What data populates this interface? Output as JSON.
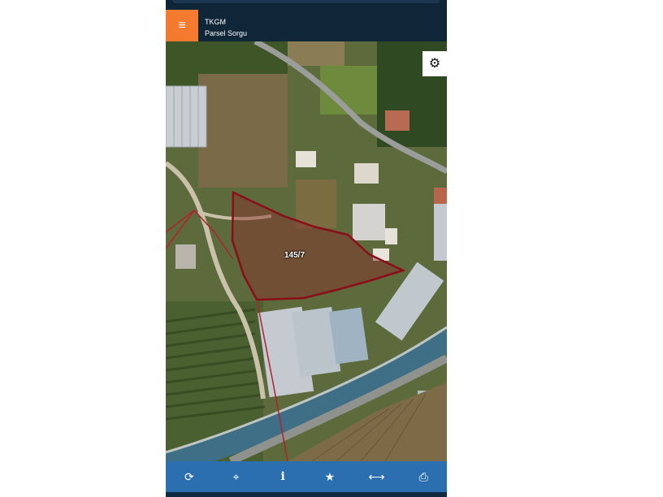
{
  "header": {
    "title": "TKGM",
    "subtitle": "Parsel Sorgu",
    "menu_icon": "≡",
    "accent_color": "#f47a2f",
    "background_color": "#0f2538"
  },
  "map": {
    "parcel_label": "145/7",
    "parcel_outline_color": "#8b0d1a",
    "settings_icon": "⚙"
  },
  "toolbar": {
    "background_color": "#2c6fb1",
    "buttons": [
      {
        "name": "refresh-icon",
        "glyph": "⟳"
      },
      {
        "name": "locate-icon",
        "glyph": "⌖"
      },
      {
        "name": "info-icon",
        "glyph": "i"
      },
      {
        "name": "favorite-icon",
        "glyph": "★"
      },
      {
        "name": "measure-icon",
        "glyph": "⟷"
      },
      {
        "name": "print-icon",
        "glyph": "⎙"
      }
    ]
  }
}
